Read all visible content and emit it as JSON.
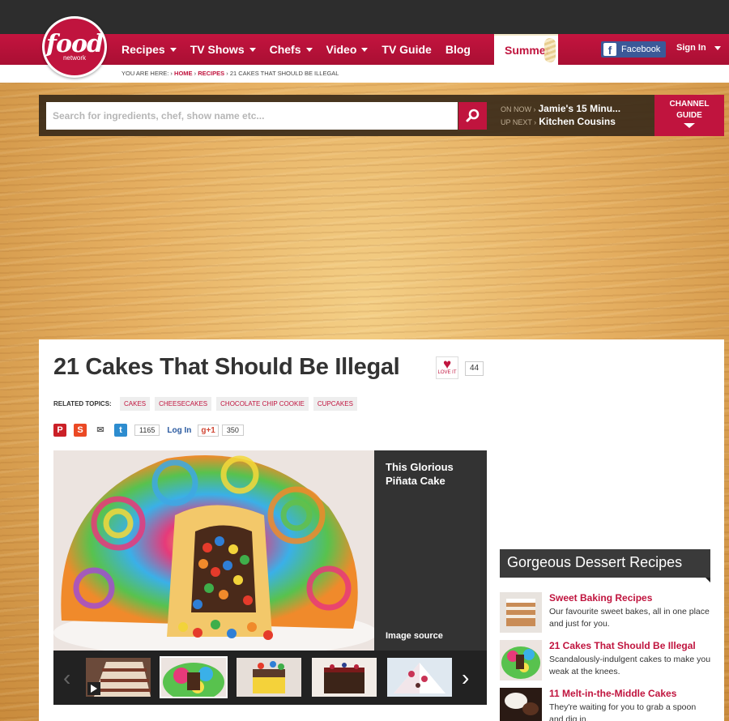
{
  "nav": {
    "logo_word": "food",
    "logo_sub": "network",
    "items": [
      {
        "label": "Recipes",
        "dropdown": true
      },
      {
        "label": "TV Shows",
        "dropdown": true
      },
      {
        "label": "Chefs",
        "dropdown": true
      },
      {
        "label": "Video",
        "dropdown": true
      },
      {
        "label": "TV Guide",
        "dropdown": false
      },
      {
        "label": "Blog",
        "dropdown": false
      }
    ],
    "summer": "Summer",
    "facebook": "Facebook",
    "signin": "Sign In"
  },
  "breadcrumb": {
    "prefix": "YOU ARE HERE: ›",
    "home": "HOME",
    "sep1": "›",
    "recipes": "RECIPES",
    "sep2": "›",
    "current": "21 CAKES THAT SHOULD BE ILLEGAL"
  },
  "search": {
    "placeholder": "Search for ingredients, chef, show name etc...",
    "on_now_label": "ON NOW ›",
    "on_now": "Jamie's 15 Minu...",
    "up_next_label": "UP NEXT ›",
    "up_next": "Kitchen Cousins",
    "channel_guide": "CHANNEL GUIDE"
  },
  "article": {
    "title": "21 Cakes That Should Be Illegal",
    "love_label": "LOVE IT",
    "love_count": "44",
    "related_label": "RELATED TOPICS:",
    "tags": [
      "CAKES",
      "CHEESECAKES",
      "CHOCOLATE CHIP COOKIE",
      "CUPCAKES"
    ],
    "tweet_count": "1165",
    "login_label": "Log In",
    "gplus_label": "g+1",
    "gplus_count": "350"
  },
  "slideshow": {
    "caption": "This Glorious Piñata Cake",
    "source": "Image source"
  },
  "sidebar": {
    "heading": "Gorgeous Dessert Recipes",
    "items": [
      {
        "title": "Sweet Baking Recipes",
        "desc": "Our favourite sweet bakes, all in one place and just for you."
      },
      {
        "title": "21 Cakes That Should Be Illegal",
        "desc": "Scandalously-indulgent cakes to make you weak at the knees."
      },
      {
        "title": "11 Melt-in-the-Middle Cakes",
        "desc": "They're waiting for you to grab a spoon and dig in."
      }
    ]
  },
  "colors": {
    "brand": "#c0143e",
    "dark": "#333333",
    "facebook": "#3b5998"
  }
}
